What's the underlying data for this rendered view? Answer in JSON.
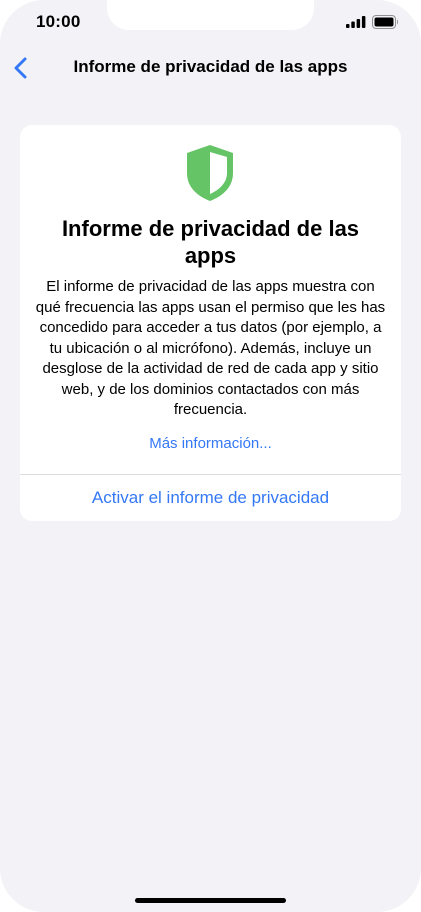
{
  "status_bar": {
    "time": "10:00",
    "signal_icon": "cellular-signal-icon",
    "battery_icon": "battery-icon"
  },
  "nav": {
    "back_icon": "chevron-left-icon",
    "title": "Informe de privacidad de las apps"
  },
  "card": {
    "icon": "shield-icon",
    "title": "Informe de privacidad de las apps",
    "body": "El informe de privacidad de las apps muestra con qué frecuencia las apps usan el permiso que les has concedido para acceder a tus datos (por ejemplo, a tu ubicación o al micrófono). Además, incluye un desglose de la actividad de red de cada app y sitio web, y de los dominios contactados con más frecuencia.",
    "more_info_link": "Más información...",
    "activate_button": "Activar el informe de privacidad"
  },
  "colors": {
    "accent": "#3478f6",
    "shield_green": "#65c466",
    "background": "#f2f2f7"
  }
}
